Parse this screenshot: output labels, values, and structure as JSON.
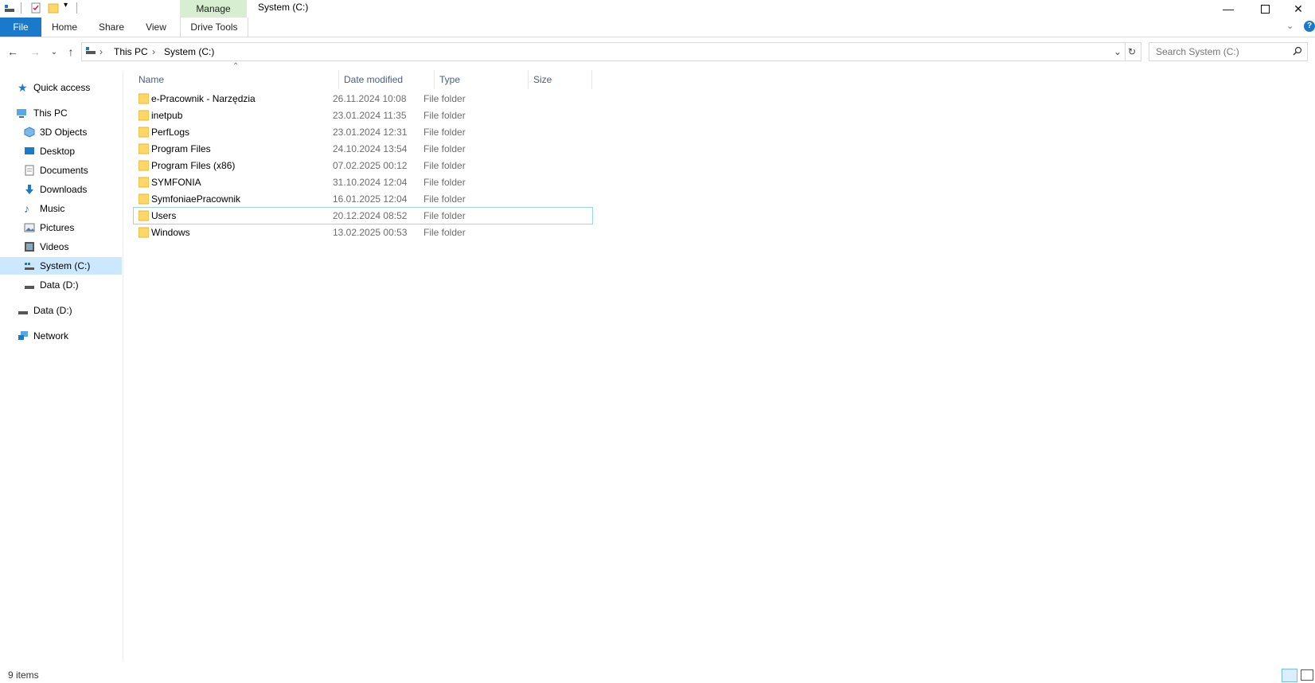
{
  "window": {
    "title": "System (C:)",
    "manage_label": "Manage",
    "minimize_icon": "minimize-icon",
    "maximize_icon": "maximize-icon",
    "close_icon": "close-icon"
  },
  "ribbon": {
    "tabs": [
      "File",
      "Home",
      "Share",
      "View",
      "Drive Tools"
    ]
  },
  "address": {
    "crumbs": [
      "This PC",
      "System (C:)"
    ],
    "search_placeholder": "Search System (C:)"
  },
  "nav": {
    "quick_access": "Quick access",
    "this_pc": "This PC",
    "items": [
      "3D Objects",
      "Desktop",
      "Documents",
      "Downloads",
      "Music",
      "Pictures",
      "Videos",
      "System (C:)",
      "Data (D:)"
    ],
    "data_drive": "Data (D:)",
    "network": "Network"
  },
  "columns": [
    "Name",
    "Date modified",
    "Type",
    "Size"
  ],
  "files": [
    {
      "name": "e-Pracownik - Narzędzia",
      "date": "26.11.2024 10:08",
      "type": "File folder",
      "size": ""
    },
    {
      "name": "inetpub",
      "date": "23.01.2024 11:35",
      "type": "File folder",
      "size": ""
    },
    {
      "name": "PerfLogs",
      "date": "23.01.2024 12:31",
      "type": "File folder",
      "size": ""
    },
    {
      "name": "Program Files",
      "date": "24.10.2024 13:54",
      "type": "File folder",
      "size": ""
    },
    {
      "name": "Program Files (x86)",
      "date": "07.02.2025 00:12",
      "type": "File folder",
      "size": ""
    },
    {
      "name": "SYMFONIA",
      "date": "31.10.2024 12:04",
      "type": "File folder",
      "size": ""
    },
    {
      "name": "SymfoniaePracownik",
      "date": "16.01.2025 12:04",
      "type": "File folder",
      "size": ""
    },
    {
      "name": "Users",
      "date": "20.12.2024 08:52",
      "type": "File folder",
      "size": ""
    },
    {
      "name": "Windows",
      "date": "13.02.2025 00:53",
      "type": "File folder",
      "size": ""
    }
  ],
  "status": {
    "count": "9 items"
  },
  "colors": {
    "accent": "#1979ca",
    "manage_bg": "#d7eed0",
    "selected": "#cce8ff",
    "folder": "#ffd766"
  }
}
